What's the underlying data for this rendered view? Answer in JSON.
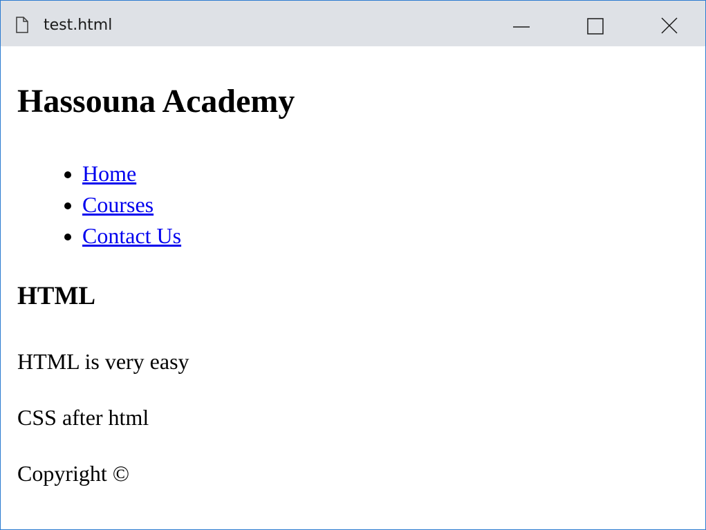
{
  "window": {
    "title": "test.html",
    "icon": "document-icon",
    "controls": [
      "minimize-icon",
      "maximize-icon",
      "close-icon"
    ]
  },
  "page": {
    "heading": "Hassouna Academy",
    "nav": [
      {
        "label": "Home"
      },
      {
        "label": "Courses"
      },
      {
        "label": "Contact Us"
      }
    ],
    "section_heading": "HTML",
    "paragraphs": [
      "HTML is very easy",
      "CSS after html",
      "Copyright ©"
    ]
  },
  "colors": {
    "titlebar": "#dee1e6",
    "window_border": "#2b7bd0",
    "link": "#0000ee",
    "text": "#000000"
  }
}
